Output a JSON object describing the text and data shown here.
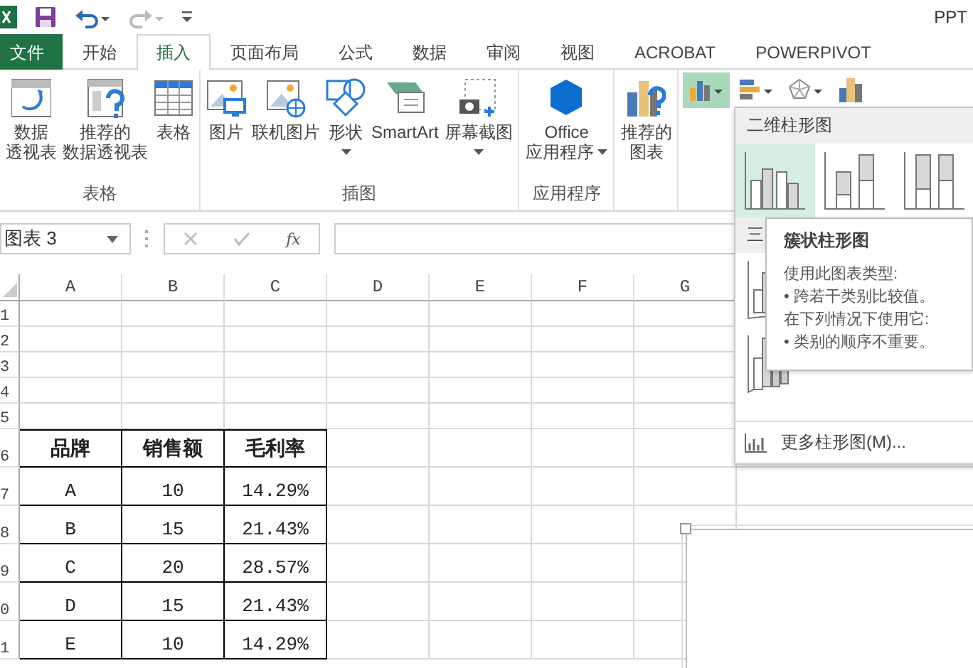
{
  "window": {
    "title": "PPT"
  },
  "tabs": [
    {
      "label": "文件",
      "kind": "file",
      "selected": false
    },
    {
      "label": "开始",
      "kind": "tab",
      "selected": false
    },
    {
      "label": "插入",
      "kind": "tab",
      "selected": true
    },
    {
      "label": "页面布局",
      "kind": "tab",
      "selected": false
    },
    {
      "label": "公式",
      "kind": "tab",
      "selected": false
    },
    {
      "label": "数据",
      "kind": "tab",
      "selected": false
    },
    {
      "label": "审阅",
      "kind": "tab",
      "selected": false
    },
    {
      "label": "视图",
      "kind": "tab",
      "selected": false
    },
    {
      "label": "ACROBAT",
      "kind": "tab",
      "selected": false
    },
    {
      "label": "POWERPIVOT",
      "kind": "tab",
      "selected": false
    }
  ],
  "ribbon": {
    "groups": [
      {
        "label": "表格",
        "buttons": [
          {
            "lines": [
              "数据",
              "透视表"
            ],
            "dropdown": false
          },
          {
            "lines": [
              "推荐的",
              "数据透视表"
            ],
            "dropdown": false
          },
          {
            "lines": [
              "表格"
            ],
            "dropdown": false
          }
        ]
      },
      {
        "label": "插图",
        "buttons": [
          {
            "lines": [
              "图片"
            ],
            "dropdown": false
          },
          {
            "lines": [
              "联机图片"
            ],
            "dropdown": false
          },
          {
            "lines": [
              "形状"
            ],
            "dropdown": true
          },
          {
            "lines": [
              "SmartArt"
            ],
            "dropdown": false
          },
          {
            "lines": [
              "屏幕截图"
            ],
            "dropdown": true
          }
        ]
      },
      {
        "label": "应用程序",
        "buttons": [
          {
            "lines": [
              "Office",
              "应用程序"
            ],
            "dropdown": true
          }
        ]
      },
      {
        "buttons": [
          {
            "lines": [
              "推荐的",
              "图表"
            ],
            "dropdown": false
          }
        ]
      }
    ],
    "chart_buttons": [
      {
        "kind": "column",
        "selected": true
      },
      {
        "kind": "bar",
        "selected": false
      },
      {
        "kind": "radar",
        "selected": false
      },
      {
        "kind": "combo",
        "selected": false
      }
    ]
  },
  "formula_bar": {
    "name_box": "图表 3",
    "function_label": "fx"
  },
  "sheet": {
    "columns": [
      "A",
      "B",
      "C",
      "D",
      "E",
      "F",
      "G"
    ],
    "empty_rows": [
      "1",
      "2",
      "3",
      "4",
      "5"
    ],
    "header_row": {
      "number": "6",
      "cells": [
        "品牌",
        "销售额",
        "毛利率"
      ]
    },
    "rows": [
      {
        "number": "7",
        "cells": [
          "A",
          "10",
          "14.29%"
        ]
      },
      {
        "number": "8",
        "cells": [
          "B",
          "15",
          "21.43%"
        ]
      },
      {
        "number": "9",
        "cells": [
          "C",
          "20",
          "28.57%"
        ]
      },
      {
        "number": "0",
        "cells": [
          "D",
          "15",
          "21.43%"
        ]
      },
      {
        "number": "1",
        "cells": [
          "E",
          "10",
          "14.29%"
        ]
      }
    ]
  },
  "chart_menu": {
    "sections": [
      {
        "title": "二维柱形图",
        "items": [
          {
            "kind": "clustered",
            "selected": true
          },
          {
            "kind": "stacked",
            "selected": false
          },
          {
            "kind": "stacked100",
            "selected": false
          }
        ]
      },
      {
        "title": "三",
        "items": [
          {
            "kind": "clustered3d",
            "selected": false
          },
          {
            "kind": "column3d",
            "selected": false
          }
        ]
      }
    ],
    "more": "更多柱形图(M)..."
  },
  "tooltip": {
    "title": "簇状柱形图",
    "lines": [
      "使用此图表类型:",
      "• 跨若干类别比较值。",
      "在下列情况下使用它:",
      "• 类别的顺序不重要。"
    ]
  }
}
